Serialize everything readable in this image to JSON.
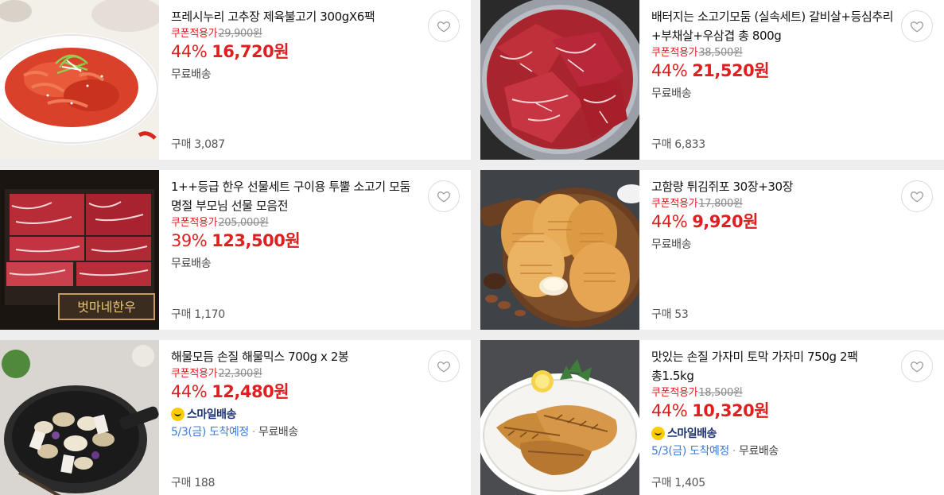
{
  "products": [
    {
      "title": "프레시누리 고추장 제육불고기 300gX6팩",
      "coupon_label": "쿠폰적용가",
      "original_price": "29,900원",
      "discount": "44%",
      "price": "16,720원",
      "shipping": "무료배송",
      "purchases": "구매 3,087",
      "image": "spicy-pork-bulgogi"
    },
    {
      "title": "배터지는 소고기모둠 (실속세트) 갈비살+등심추리+부채살+우삼겹 총 800g",
      "coupon_label": "쿠폰적용가",
      "original_price": "38,500원",
      "discount": "44%",
      "price": "21,520원",
      "shipping": "무료배송",
      "purchases": "구매 6,833",
      "image": "raw-beef-platter"
    },
    {
      "title": "1++등급 한우 선물세트 구이용 투뿔 소고기 모둠 명절 부모님 선물 모음전",
      "coupon_label": "쿠폰적용가",
      "original_price": "205,000원",
      "discount": "39%",
      "price": "123,500원",
      "shipping": "무료배송",
      "purchases": "구매 1,170",
      "image": "hanwoo-gift-set",
      "box_text": "벗마네한우"
    },
    {
      "title": "고함량 튀김쥐포 30장+30장",
      "coupon_label": "쿠폰적용가",
      "original_price": "17,800원",
      "discount": "44%",
      "price": "9,920원",
      "shipping": "무료배송",
      "purchases": "구매 53",
      "image": "fried-filefish-snack"
    },
    {
      "title": "해물모듬 손질 해물믹스 700g x 2봉",
      "coupon_label": "쿠폰적용가",
      "original_price": "22,300원",
      "discount": "44%",
      "price": "12,480원",
      "smile_label": "스마일배송",
      "arrival": "5/3(금) 도착예정",
      "shipping": "무료배송",
      "purchases": "구매 188",
      "image": "seafood-mix-pan"
    },
    {
      "title": "맛있는 손질 가자미 토막 가자미 750g 2팩 총1.5kg",
      "coupon_label": "쿠폰적용가",
      "original_price": "18,500원",
      "discount": "44%",
      "price": "10,320원",
      "smile_label": "스마일배송",
      "arrival": "5/3(금) 도착예정",
      "shipping": "무료배송",
      "purchases": "구매 1,405",
      "image": "grilled-flounder"
    }
  ],
  "colors": {
    "price_red": "#e02020",
    "arrival_blue": "#3e7bd6",
    "smile_navy": "#1c3170",
    "smile_yellow": "#ffcc00"
  },
  "icons": {
    "wishlist": "heart-outline-icon",
    "smile_delivery": "smile-face-icon"
  }
}
